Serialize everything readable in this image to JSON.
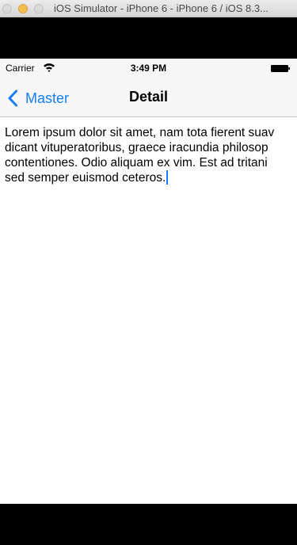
{
  "window": {
    "title": "iOS Simulator - iPhone 6 - iPhone 6 / iOS 8.3..."
  },
  "statusbar": {
    "carrier": "Carrier",
    "time": "3:49 PM",
    "wifi_icon": "wifi-icon",
    "battery_icon": "battery-icon"
  },
  "navbar": {
    "back_label": "Master",
    "title": "Detail",
    "accent_color": "#147efb"
  },
  "content": {
    "lines": [
      "Lorem ipsum dolor sit amet, nam tota fierent suav",
      "dicant vituperatoribus, graece iracundia philosop",
      "contentiones. Odio aliquam ex vim. Est ad tritani",
      "sed semper euismod ceteros."
    ]
  }
}
